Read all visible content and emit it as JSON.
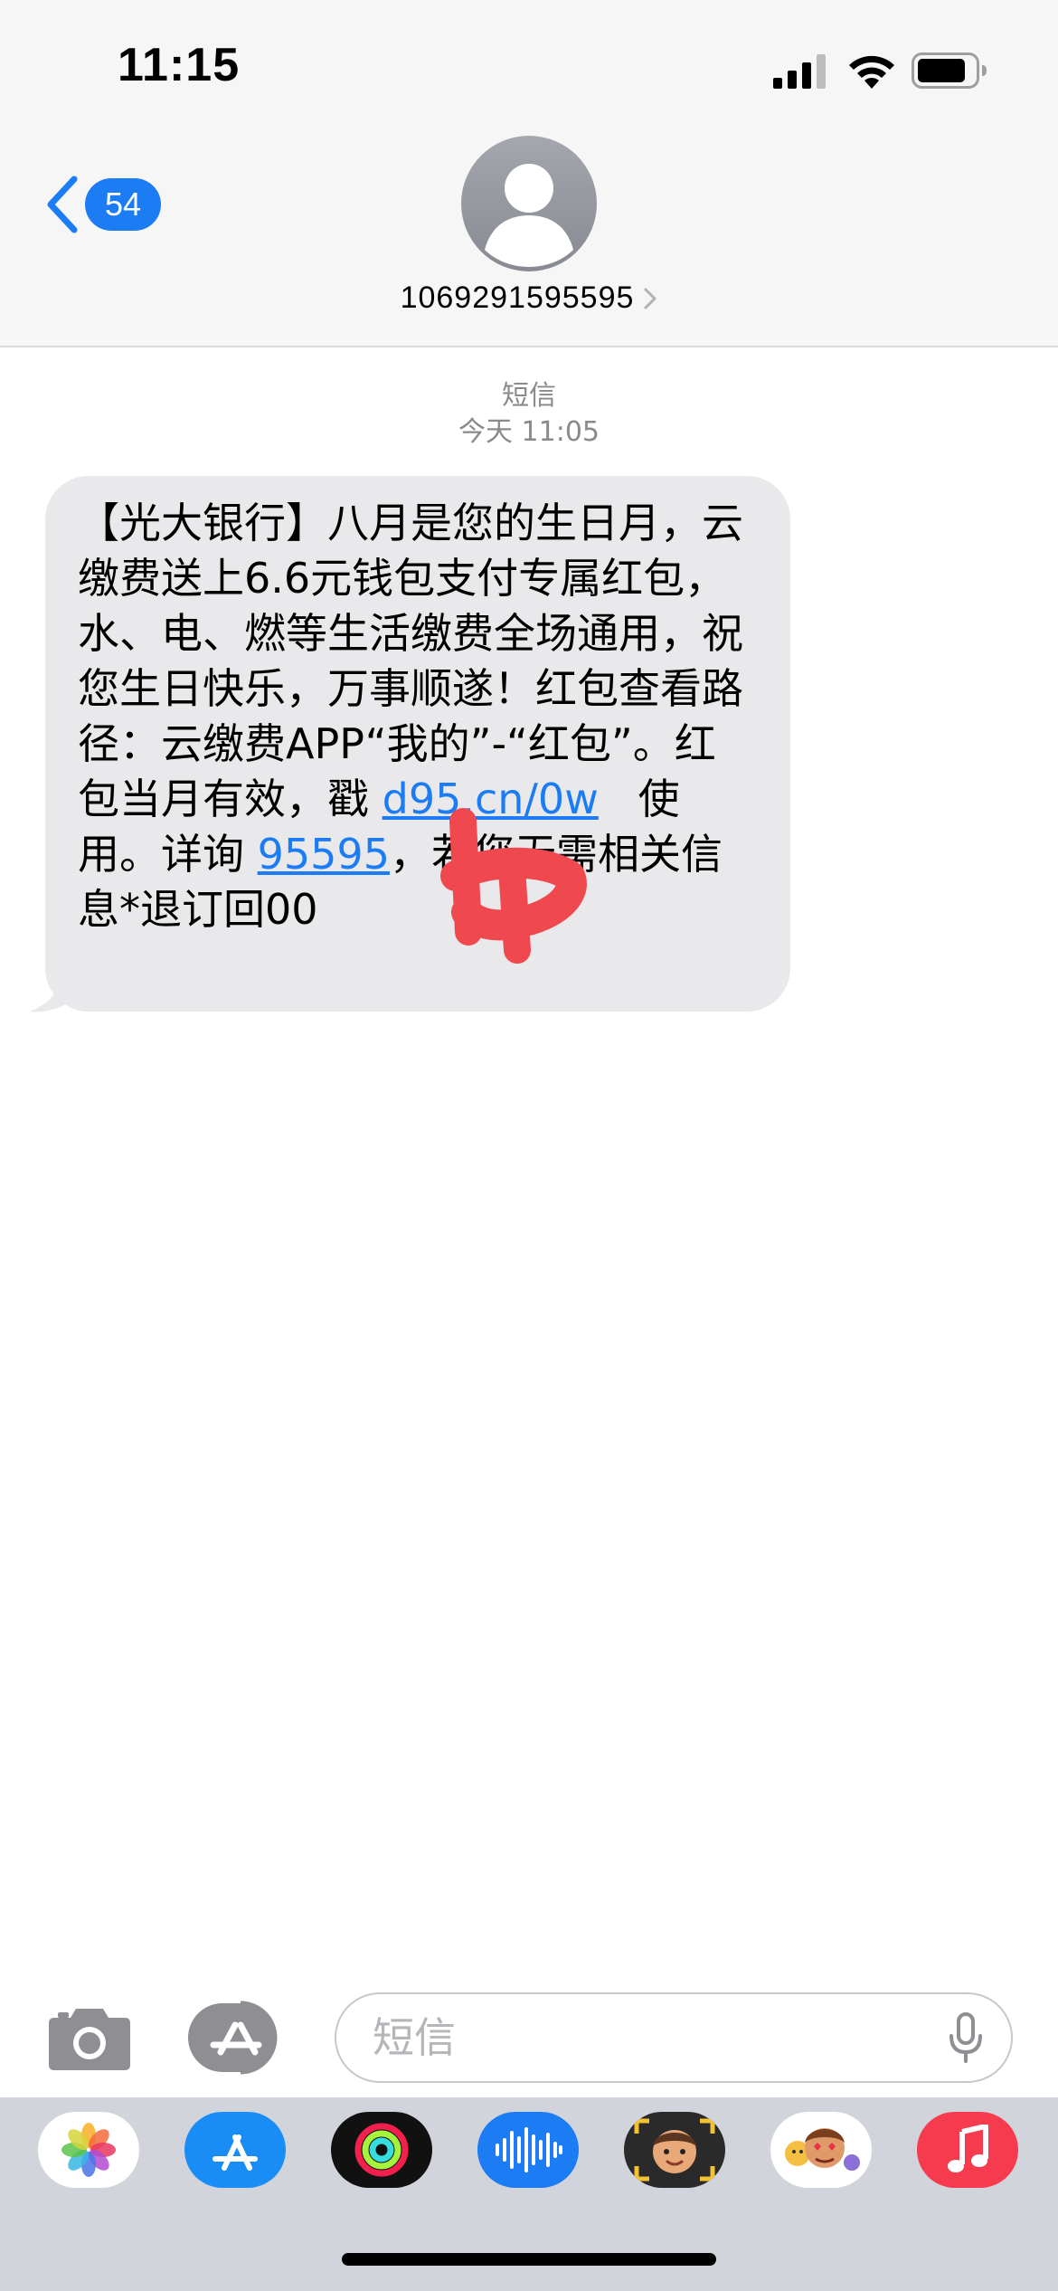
{
  "status_bar": {
    "time": "11:15"
  },
  "nav": {
    "back_count": "54",
    "contact_number": "1069291595595"
  },
  "conversation": {
    "service_label": "短信",
    "time_label": "今天 11:05",
    "message": {
      "text_before_link": "【光大银行】八月是您的生日月，云缴费送上6.6元钱包支付专属红包，水、电、燃等生活缴费全场通用，祝您生日快乐，万事顺遂！红包查看路径：云缴费APP“我的”-“红包”。红包当月有效，戳 ",
      "link_url": "d95.cn/0w",
      "text_middle": "   使用。详询 ",
      "link_phone": "95595",
      "text_end": "，若您无需相关信息*退订回00"
    }
  },
  "input_bar": {
    "placeholder": "短信"
  },
  "app_drawer": {
    "apps": [
      {
        "name": "photos",
        "color": "#ffffff"
      },
      {
        "name": "app-store",
        "color": "#1a8cf5"
      },
      {
        "name": "activity",
        "color": "#111111"
      },
      {
        "name": "audio-message",
        "color": "#1c7cf4"
      },
      {
        "name": "memoji",
        "color": "#f2c230"
      },
      {
        "name": "animoji-stickers",
        "color": "#ffffff"
      },
      {
        "name": "music",
        "color": "#f73b4f"
      }
    ]
  },
  "colors": {
    "accent": "#1c7cf4",
    "bubble": "#e9e9eb",
    "header_bg": "#f6f6f6",
    "drawer_bg": "#d1d4db",
    "redaction": "#f0484f"
  }
}
